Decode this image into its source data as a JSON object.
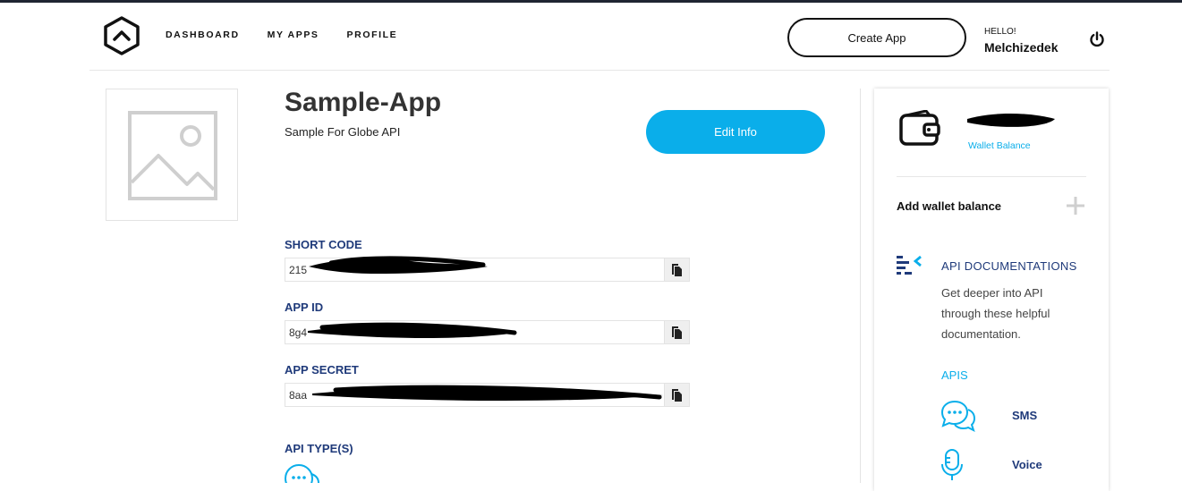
{
  "nav": {
    "items": [
      "DASHBOARD",
      "MY APPS",
      "PROFILE"
    ]
  },
  "header": {
    "create_app_label": "Create App",
    "greeting": "HELLO!",
    "username": "Melchizedek"
  },
  "app": {
    "title": "Sample-App",
    "description": "Sample For Globe API",
    "edit_label": "Edit Info"
  },
  "fields": [
    {
      "label": "SHORT CODE",
      "value": "215"
    },
    {
      "label": "APP ID",
      "value": "8g4"
    },
    {
      "label": "APP SECRET",
      "value": "8aa"
    }
  ],
  "api_types": {
    "label": "API TYPE(S)"
  },
  "wallet": {
    "label": "Wallet Balance",
    "add_label": "Add wallet balance"
  },
  "docs": {
    "title": "API DOCUMENTATIONS",
    "description": "Get deeper into API through these helpful documentation.",
    "apis_label": "APIS",
    "items": [
      "SMS",
      "Voice"
    ]
  },
  "colors": {
    "accent": "#0aaeea",
    "label_navy": "#1f3a7a"
  }
}
